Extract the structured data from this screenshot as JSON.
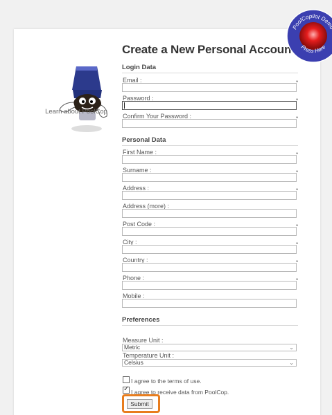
{
  "learn_link": "Learn about PoolCop",
  "title": "Create a New Personal Account",
  "badge": {
    "top_text": "PoolCopilot Demo",
    "bottom_text": "Press Here",
    "color_ring": "#3b3fb0",
    "color_center": "#e51d1d"
  },
  "sections": {
    "login": "Login Data",
    "personal": "Personal Data",
    "preferences": "Preferences"
  },
  "fields": {
    "email": "Email :",
    "password": "Password :",
    "confirm_password": "Confirm Your Password :",
    "first_name": "First Name :",
    "surname": "Surname :",
    "address": "Address :",
    "address_more": "Address (more) :",
    "post_code": "Post Code :",
    "city": "City :",
    "country": "Country :",
    "phone": "Phone :",
    "mobile": "Mobile :"
  },
  "required_mark": "*",
  "prefs": {
    "measure_label": "Measure Unit :",
    "measure_value": "Metric",
    "temperature_label": "Temperature Unit :",
    "temperature_value": "Celsius"
  },
  "checkboxes": {
    "terms": {
      "label": "I agree to the terms of use.",
      "checked": false
    },
    "data": {
      "label": "I agree to receive data from PoolCop.",
      "checked": true
    }
  },
  "submit_label": "Submit",
  "highlight_color": "#e87d1e"
}
